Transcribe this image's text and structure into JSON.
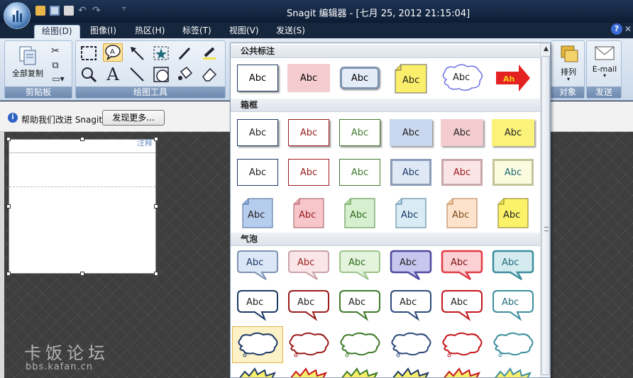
{
  "window": {
    "title": "Snagit 编辑器 - [七月 25, 2012 21:15:04]"
  },
  "ribbon_tabs": [
    {
      "label": "绘图(D)",
      "active": true
    },
    {
      "label": "图像(I)"
    },
    {
      "label": "热区(H)"
    },
    {
      "label": "标签(T)"
    },
    {
      "label": "视图(V)"
    },
    {
      "label": "发送(S)"
    }
  ],
  "groups": {
    "clipboard": {
      "label": "剪贴板",
      "copy_all": "全部复制"
    },
    "drawing_tools": {
      "label": "绘图工具"
    },
    "arrange": {
      "label": "对象",
      "button": "排列"
    },
    "send": {
      "label": "发送",
      "button": "E-mail"
    }
  },
  "infobar": {
    "text": "帮助我们改进 Snagit",
    "button": "发现更多..."
  },
  "gallery": {
    "sections": [
      {
        "title": "公共标注"
      },
      {
        "title": "箱框"
      },
      {
        "title": "气泡"
      }
    ],
    "sample_text": "Abc",
    "arrow_text": "Ah"
  },
  "paper": {
    "corner_text": "注释"
  },
  "watermark": {
    "line1": "卡饭论坛",
    "line2": "bbs.kafan.cn"
  },
  "colors": {
    "accent_red": "#e52222",
    "selection": "#fde49a",
    "ribbon_header": "#6d89ae"
  }
}
